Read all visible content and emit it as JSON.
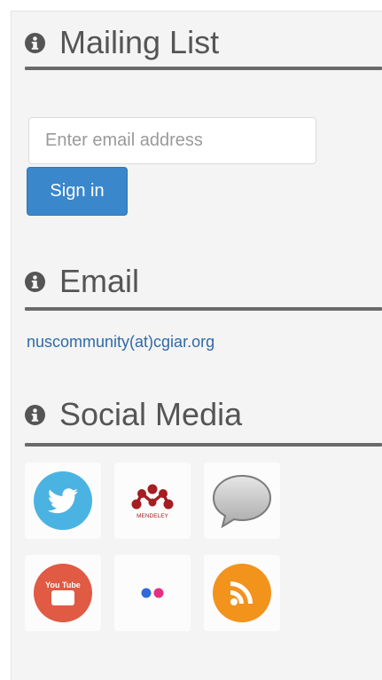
{
  "mailing_list": {
    "title": "Mailing List",
    "email_placeholder": "Enter email address",
    "signin_label": "Sign in"
  },
  "email_section": {
    "title": "Email",
    "address": "nuscommunity(at)cgiar.org"
  },
  "social_section": {
    "title": "Social Media",
    "icons": [
      "twitter-icon",
      "mendeley-icon",
      "chat-bubble-icon",
      "youtube-icon",
      "flickr-icon",
      "rss-icon"
    ],
    "mendeley_caption": "MENDELEY",
    "youtube_caption": "You Tube"
  },
  "colors": {
    "accent": "#3a87cb",
    "heading": "#555555",
    "link": "#2f6aa8",
    "twitter": "#4bb3e2",
    "mendeley": "#a51e22",
    "youtube": "#e05a44",
    "flickr_blue": "#2f6ad8",
    "flickr_pink": "#e6307f",
    "rss": "#f2931c"
  }
}
